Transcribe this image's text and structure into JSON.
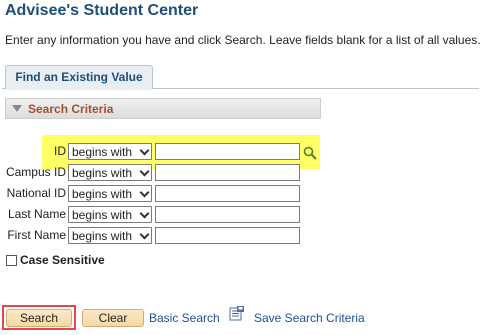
{
  "page": {
    "title": "Advisee's Student Center",
    "instructions": "Enter any information you have and click Search. Leave fields blank for a list of all values."
  },
  "tab": {
    "label": "Find an Existing Value"
  },
  "criteria": {
    "header": "Search Criteria",
    "fields": [
      {
        "label": "ID",
        "operator": "begins with",
        "value": ""
      },
      {
        "label": "Campus ID",
        "operator": "begins with",
        "value": ""
      },
      {
        "label": "National ID",
        "operator": "begins with",
        "value": ""
      },
      {
        "label": "Last Name",
        "operator": "begins with",
        "value": ""
      },
      {
        "label": "First Name",
        "operator": "begins with",
        "value": ""
      }
    ],
    "case_sensitive_label": "Case Sensitive",
    "case_sensitive_checked": false
  },
  "actions": {
    "search_label": "Search",
    "clear_label": "Clear",
    "basic_search_label": "Basic Search",
    "save_criteria_label": "Save Search Criteria"
  },
  "colors": {
    "title": "#1f4e79",
    "criteria_header_text": "#a0522d",
    "highlight": "#ffff66",
    "search_outline": "#e2494b",
    "link": "#1f4e9c"
  },
  "icons": {
    "lookup": "magnifier-icon",
    "save": "save-criteria-icon",
    "collapse": "collapse-triangle-icon"
  }
}
